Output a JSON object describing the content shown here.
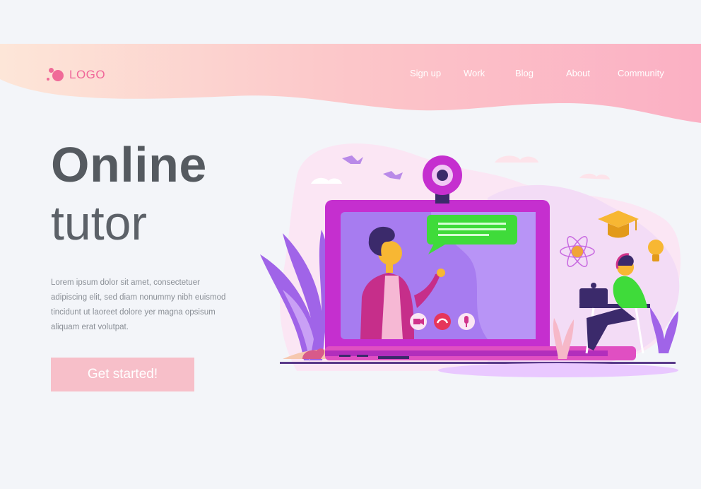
{
  "header": {
    "logo_text": "LOGO",
    "nav": [
      {
        "label": "Sign up"
      },
      {
        "label": "Work"
      },
      {
        "label": "Blog"
      },
      {
        "label": "About"
      },
      {
        "label": "Community"
      }
    ]
  },
  "hero": {
    "title_line1": "Online",
    "title_line2": "tutor",
    "description": "Lorem ipsum dolor sit amet, consectetuer adipiscing elit, sed diam nonummy nibh euismod tincidunt ut laoreet dolore yer magna opsisum aliquam erat volutpat.",
    "cta_label": "Get started!"
  },
  "colors": {
    "accent_pink": "#f06a98",
    "header_gradient_start": "#fde3d6",
    "header_gradient_end": "#fbb0c4",
    "laptop_magenta": "#c52fcf",
    "screen_violet": "#a77cf0",
    "chat_green": "#3fdb3a"
  },
  "icons": {
    "logo": "bubbles-logo-icon",
    "webcam": "webcam-icon",
    "video_call": "video-camera-icon",
    "hang_up": "phone-hangup-icon",
    "mic": "microphone-icon",
    "grad_cap": "graduation-cap-icon",
    "atom": "atom-icon",
    "idea": "lightbulb-icon"
  }
}
